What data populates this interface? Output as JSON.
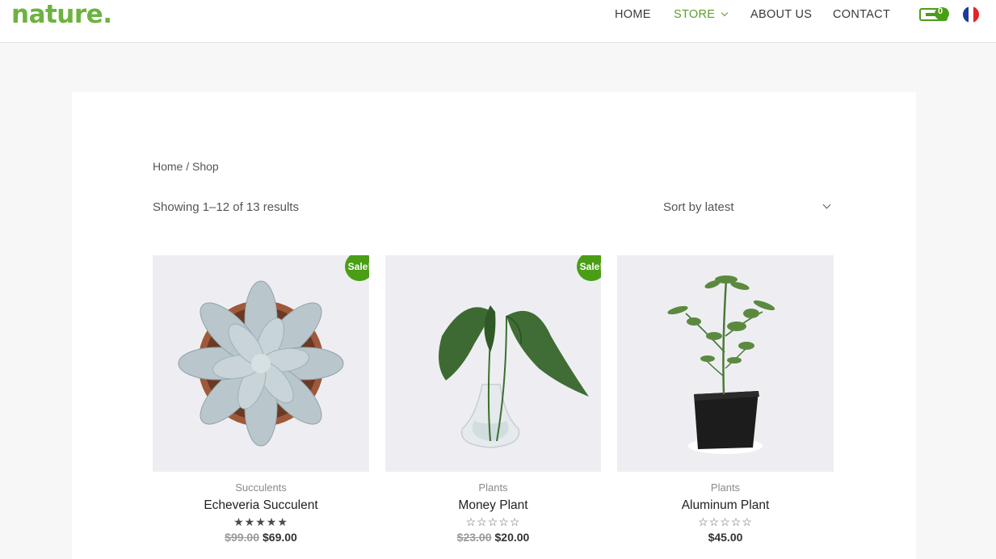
{
  "header": {
    "logo": "nature.",
    "nav": [
      {
        "label": "HOME"
      },
      {
        "label": "STORE"
      },
      {
        "label": "ABOUT US"
      },
      {
        "label": "CONTACT"
      }
    ],
    "cart_count": "0",
    "accent_color": "#6cb33f",
    "badge_color": "#4a9e16"
  },
  "breadcrumb": "Home / Shop",
  "result_count": "Showing 1–12 of 13 results",
  "sort": {
    "selected": "Sort by latest"
  },
  "products": [
    {
      "category": "Succulents",
      "name": "Echeveria Succulent",
      "badge": "Sale!",
      "rating": 5,
      "stars": "★★★★★",
      "old_price": "$99.00",
      "price": "$69.00"
    },
    {
      "category": "Plants",
      "name": "Money Plant",
      "badge": "Sale!",
      "rating": 0,
      "stars": "☆☆☆☆☆",
      "old_price": "$23.00",
      "price": "$20.00"
    },
    {
      "category": "Plants",
      "name": "Aluminum Plant",
      "badge": "",
      "rating": 0,
      "stars": "☆☆☆☆☆",
      "old_price": "",
      "price": "$45.00"
    }
  ]
}
